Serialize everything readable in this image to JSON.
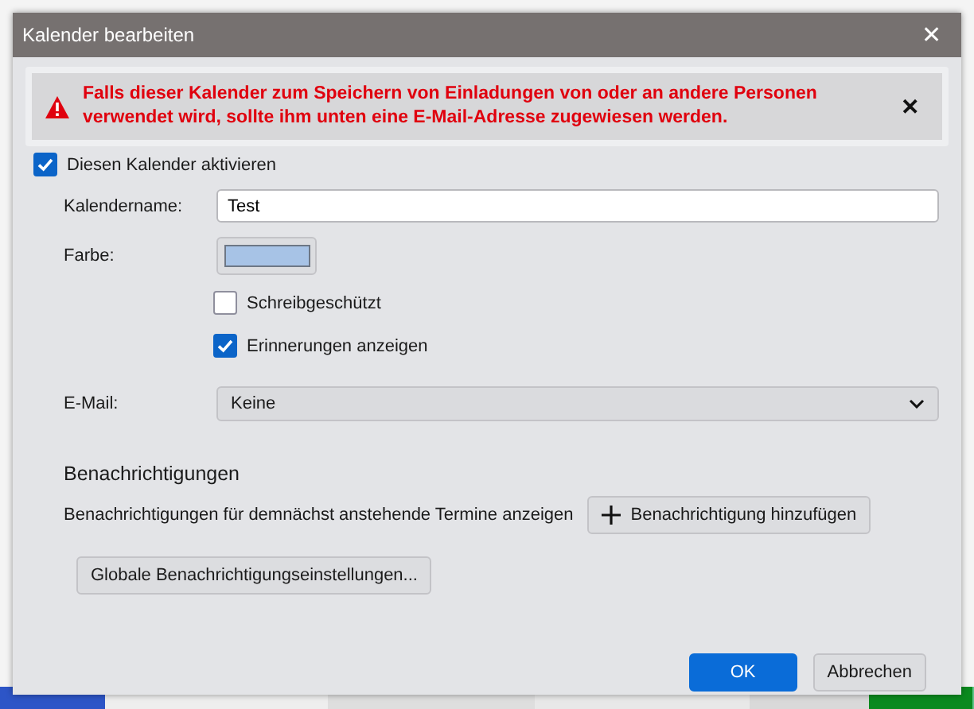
{
  "window": {
    "title": "Kalender bearbeiten",
    "close": "✕"
  },
  "warning": {
    "text": "Falls dieser Kalender zum Speichern von Einladungen von oder an andere Personen verwendet wird, sollte ihm unten eine E-Mail-Adresse zugewiesen werden.",
    "dismiss": "✕"
  },
  "enable": {
    "label": "Diesen Kalender aktivieren",
    "checked": true
  },
  "name": {
    "label": "Kalendername:",
    "value": "Test"
  },
  "color": {
    "label": "Farbe:",
    "color": "#a7c3e6"
  },
  "options": [
    {
      "label": "Schreibgeschützt",
      "checked": false
    },
    {
      "label": "Erinnerungen anzeigen",
      "checked": true
    }
  ],
  "email": {
    "label": "E-Mail:",
    "value": "Keine"
  },
  "notifications": {
    "heading": "Benachrichtigungen",
    "description": "Benachrichtigungen für demnächst anstehende Termine anzeigen",
    "add_button": "Benachrichtigung hinzufügen",
    "global_button": "Globale Benachrichtigungseinstellungen..."
  },
  "buttons": [
    {
      "label": "OK",
      "kind": "primary"
    },
    {
      "label": "Abbrechen",
      "kind": "secondary"
    }
  ]
}
